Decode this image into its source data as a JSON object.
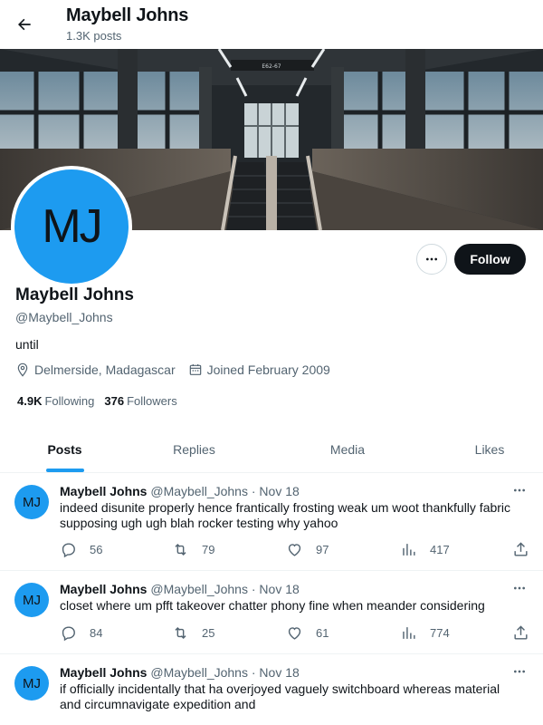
{
  "header": {
    "title": "Maybell Johns",
    "post_count": "1.3K posts"
  },
  "profile": {
    "initials": "MJ",
    "display_name": "Maybell Johns",
    "handle": "@Maybell_Johns",
    "bio": "until",
    "location": "Delmerside, Madagascar",
    "joined": "Joined February 2009",
    "following_count": "4.9K",
    "following_label": "Following",
    "followers_count": "376",
    "followers_label": "Followers",
    "follow_label": "Follow",
    "banner_sign": "E62-67"
  },
  "tabs": [
    {
      "label": "Posts",
      "active": true
    },
    {
      "label": "Replies",
      "active": false
    },
    {
      "label": "Media",
      "active": false
    },
    {
      "label": "Likes",
      "active": false
    }
  ],
  "posts": [
    {
      "initials": "MJ",
      "name": "Maybell Johns",
      "handle": "@Maybell_Johns",
      "sep": "·",
      "date": "Nov 18",
      "text": "indeed disunite properly hence frantically frosting weak um woot thankfully fabric supposing ugh ugh blah rocker testing why yahoo",
      "replies": "56",
      "reposts": "79",
      "likes": "97",
      "views": "417"
    },
    {
      "initials": "MJ",
      "name": "Maybell Johns",
      "handle": "@Maybell_Johns",
      "sep": "·",
      "date": "Nov 18",
      "text": "closet where um pfft takeover chatter phony fine when meander considering",
      "replies": "84",
      "reposts": "25",
      "likes": "61",
      "views": "774"
    },
    {
      "initials": "MJ",
      "name": "Maybell Johns",
      "handle": "@Maybell_Johns",
      "sep": "·",
      "date": "Nov 18",
      "text": "if officially incidentally that ha overjoyed vaguely switchboard whereas material and circumnavigate expedition and"
    }
  ],
  "colors": {
    "accent": "#1d9bf0",
    "text": "#0f1419",
    "muted": "#536471",
    "follow_bg": "#0f1419"
  },
  "icons": {
    "back": "arrow-left-icon",
    "more": "ellipsis-icon",
    "location": "location-pin-icon",
    "joined": "calendar-icon",
    "reply": "reply-icon",
    "repost": "repost-icon",
    "like": "heart-icon",
    "views": "views-chart-icon",
    "share": "share-icon"
  }
}
